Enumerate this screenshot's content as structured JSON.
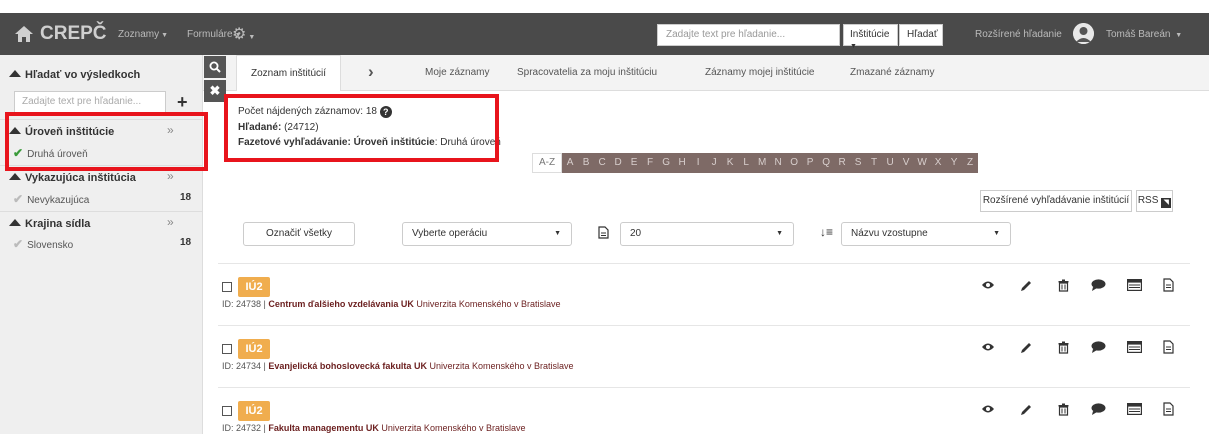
{
  "navbar": {
    "brand": "CREPČ",
    "menu": [
      {
        "label": "Zoznamy"
      },
      {
        "label": "Formuláre"
      }
    ],
    "search_placeholder": "Zadajte text pre hľadanie...",
    "scope_label": "Inštitúcie",
    "search_button": "Hľadať",
    "advanced_search": "Rozšírené hľadanie",
    "user_name": "Tomáš Bareán"
  },
  "sidebar": {
    "search_heading": "Hľadať vo výsledkoch",
    "search_placeholder": "Zadajte text pre hľadanie...",
    "facets": [
      {
        "title": "Úroveň inštitúcie",
        "items": [
          {
            "label": "Druhá úroveň",
            "count": "",
            "selected": true
          }
        ]
      },
      {
        "title": "Vykazujúca inštitúcia",
        "items": [
          {
            "label": "Nevykazujúca",
            "count": "18",
            "selected": false
          }
        ]
      },
      {
        "title": "Krajina sídla",
        "items": [
          {
            "label": "Slovensko",
            "count": "18",
            "selected": false
          }
        ]
      }
    ]
  },
  "tabs": [
    {
      "label": "Zoznam inštitúcií",
      "active": true
    },
    {
      "label": "Moje záznamy",
      "active": false
    },
    {
      "label": "Spracovatelia za moju inštitúciu",
      "active": false
    },
    {
      "label": "Záznamy mojej inštitúcie",
      "active": false
    },
    {
      "label": "Zmazané záznamy",
      "active": false
    }
  ],
  "info": {
    "count_label": "Počet nájdených záznamov: 18",
    "searched_label": "Hľadané:",
    "searched_value": " (24712)",
    "facet_label": "Fazetové vyhľadávanie:",
    "facet_name": " Úroveň inštitúcie",
    "facet_value": ": Druhá úroveň"
  },
  "letters": {
    "all": "A-Z",
    "items": [
      "A",
      "B",
      "C",
      "D",
      "E",
      "F",
      "G",
      "H",
      "I",
      "J",
      "K",
      "L",
      "M",
      "N",
      "O",
      "P",
      "Q",
      "R",
      "S",
      "T",
      "U",
      "V",
      "W",
      "X",
      "Y",
      "Z"
    ]
  },
  "buttons": {
    "advanced_institutions": "Rozšírené vyhľadávanie inštitúcií",
    "rss": "RSS",
    "select_all": "Označiť všetky",
    "operation": "Vyberte operáciu",
    "page_size": "20",
    "sort": "Názvu vzostupne"
  },
  "records": [
    {
      "badge": "IÚ2",
      "id_text": "ID: 24738 | ",
      "name": "Centrum ďalšieho vzdelávania UK",
      "org": "Univerzita Komenského v Bratislave"
    },
    {
      "badge": "IÚ2",
      "id_text": "ID: 24734 | ",
      "name": "Evanjelická bohoslovecká fakulta UK",
      "org": "Univerzita Komenského v Bratislave"
    },
    {
      "badge": "IÚ2",
      "id_text": "ID: 24732 | ",
      "name": "Fakulta managementu UK",
      "org": "Univerzita Komenského v Bratislave"
    }
  ],
  "colors": {
    "navbar": "#4a4a4a",
    "letter_bg": "#7e6a66",
    "badge": "#f0ad4e",
    "highlight": "#e8141c",
    "selected_check": "#3a9a3a"
  }
}
